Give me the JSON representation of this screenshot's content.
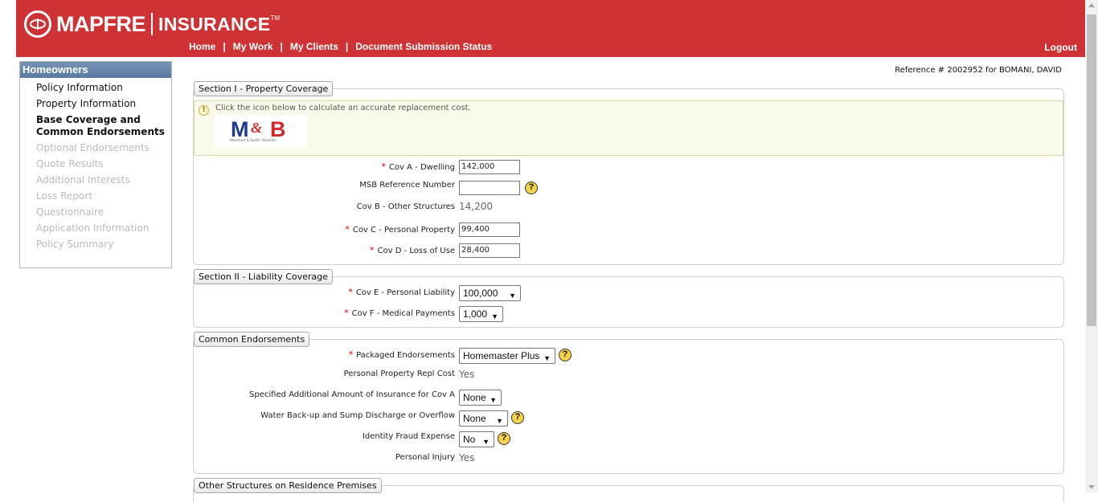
{
  "header": {
    "brand": "MAPFRE",
    "product": "INSURANCE",
    "trademark": "TM",
    "nav": [
      "Home",
      "My Work",
      "My Clients",
      "Document Submission Status"
    ],
    "separator": "|",
    "logout": "Logout",
    "background_color": "#cf3234"
  },
  "sidebar": {
    "title": "Homeowners",
    "items": [
      {
        "label": "Policy Information",
        "state": "enabled"
      },
      {
        "label": "Property Information",
        "state": "enabled"
      },
      {
        "label": "Base Coverage and Common Endorsements",
        "state": "active"
      },
      {
        "label": "Optional Endorsements",
        "state": "disabled"
      },
      {
        "label": "Quote Results",
        "state": "disabled"
      },
      {
        "label": "Additional Interests",
        "state": "disabled"
      },
      {
        "label": "Loss Report",
        "state": "disabled"
      },
      {
        "label": "Questionnaire",
        "state": "disabled"
      },
      {
        "label": "Application Information",
        "state": "disabled"
      },
      {
        "label": "Policy Summary",
        "state": "disabled"
      }
    ]
  },
  "reference": "Reference # 2002952 for BOMANI, DAVID",
  "section1": {
    "title": "Section I - Property Coverage",
    "info_text": "Click the icon below to calculate an accurate replacement cost.",
    "msb_logo": {
      "m": "M",
      "amp": "&",
      "b": "B",
      "caption": "Marshall & Swift / Boeckh"
    },
    "cov_a_label": "Cov A - Dwelling",
    "cov_a_value": "142,000",
    "msb_ref_label": "MSB Reference Number",
    "msb_ref_value": "",
    "cov_b_label": "Cov B - Other Structures",
    "cov_b_value": "14,200",
    "cov_c_label": "Cov C - Personal Property",
    "cov_c_value": "99,400",
    "cov_d_label": "Cov D - Loss of Use",
    "cov_d_value": "28,400"
  },
  "section2": {
    "title": "Section II - Liability Coverage",
    "cov_e_label": "Cov E - Personal Liability",
    "cov_e_value": "100,000",
    "cov_f_label": "Cov F - Medical Payments",
    "cov_f_value": "1,000"
  },
  "endorsements": {
    "title": "Common Endorsements",
    "packaged_label": "Packaged Endorsements",
    "packaged_value": "Homemaster Plus",
    "ppr_label": "Personal Property Repl Cost",
    "ppr_value": "Yes",
    "spec_label": "Specified Additional Amount of Insurance for Cov A",
    "spec_value": "None",
    "water_label": "Water Back-up and Sump Discharge or Overflow",
    "water_value": "None",
    "identity_label": "Identity Fraud Expense",
    "identity_value": "No",
    "personal_injury_label": "Personal Injury",
    "personal_injury_value": "Yes"
  },
  "other_structures": {
    "title": "Other Structures on Residence Premises"
  },
  "common": {
    "required_mark": "*",
    "help_glyph": "?",
    "info_glyph": "!",
    "dropdown_glyph": "▼"
  }
}
